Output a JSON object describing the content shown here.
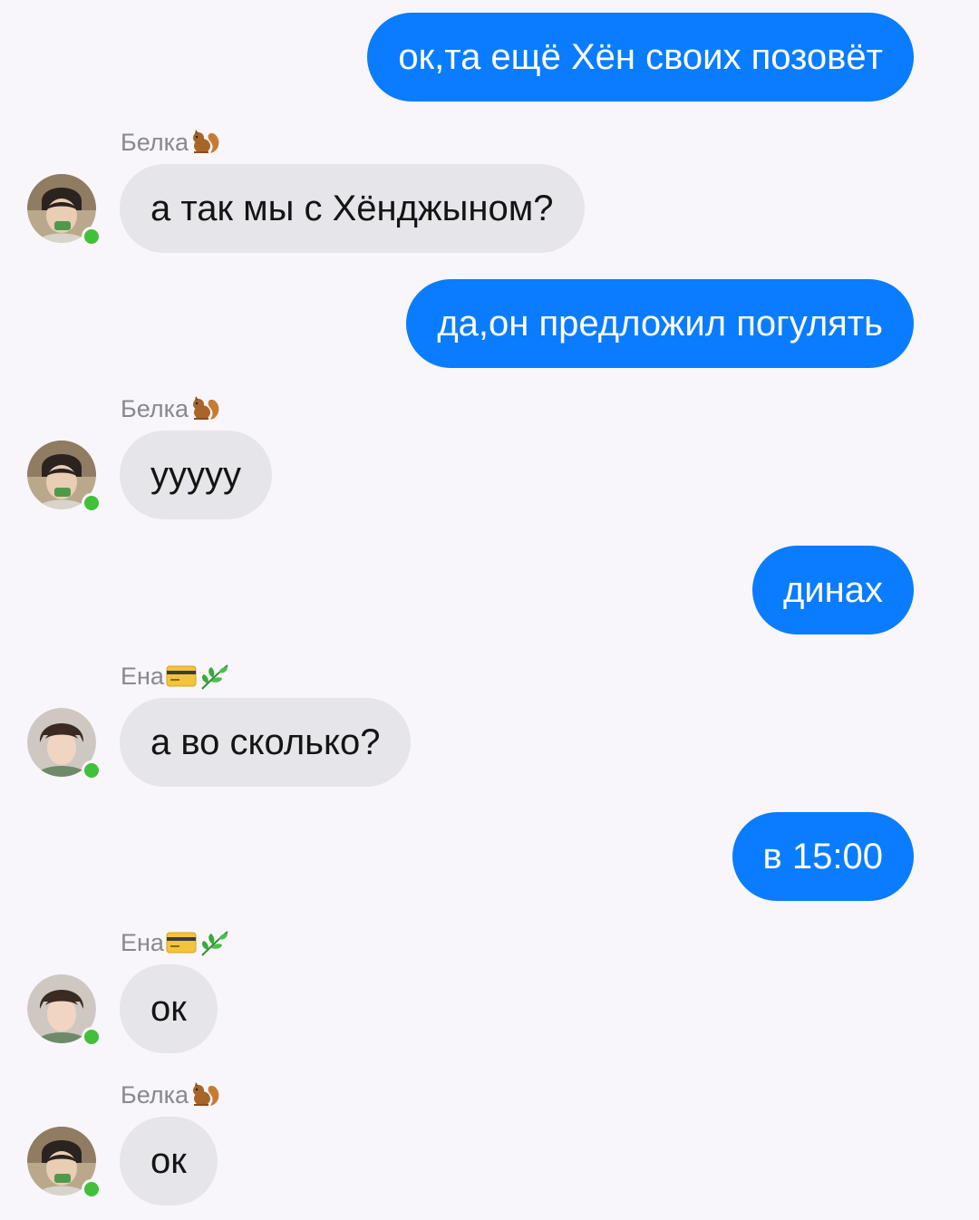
{
  "messages": [
    {
      "direction": "outgoing",
      "text": "ок,та ещё Хён своих позовёт"
    },
    {
      "direction": "incoming",
      "sender": "Белка",
      "sender_emoji": "squirrel-emoji",
      "avatar": "belka-avatar",
      "text": "а так мы с Хёнджыном?"
    },
    {
      "direction": "outgoing",
      "text": "да,он предложил погулять"
    },
    {
      "direction": "incoming",
      "sender": "Белка",
      "sender_emoji": "squirrel-emoji",
      "avatar": "belka-avatar",
      "text": "ууууу"
    },
    {
      "direction": "outgoing",
      "text": "динах"
    },
    {
      "direction": "incoming",
      "sender": "Ена",
      "sender_emoji": "credit-card-emoji herb-emoji",
      "avatar": "yena-avatar",
      "text": "а во сколько?"
    },
    {
      "direction": "outgoing",
      "text": "в 15:00"
    },
    {
      "direction": "incoming",
      "sender": "Ена",
      "sender_emoji": "credit-card-emoji herb-emoji",
      "avatar": "yena-avatar",
      "text": "ок"
    },
    {
      "direction": "incoming",
      "sender": "Белка",
      "sender_emoji": "squirrel-emoji",
      "avatar": "belka-avatar",
      "text": "ок"
    }
  ],
  "colors": {
    "outgoing_bubble": "#0a7cff",
    "incoming_bubble": "#e6e5ea",
    "background": "#f8f6fa",
    "sender_name": "#888890",
    "online_indicator": "#41c03a"
  }
}
